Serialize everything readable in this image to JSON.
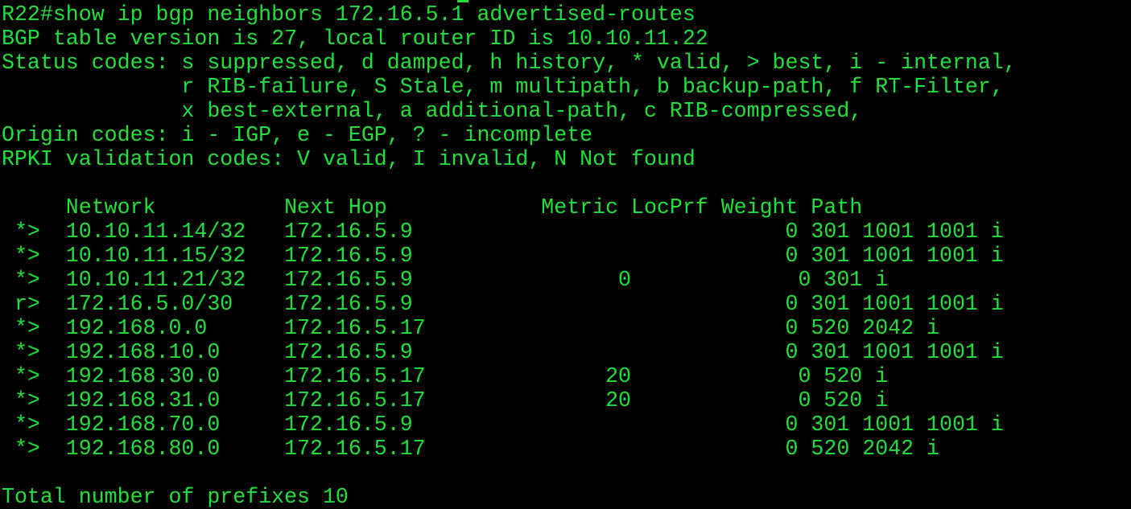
{
  "terminal": {
    "colors": {
      "background": "#000000",
      "text": "#22e03a"
    },
    "command_line": "R22#show ip bgp neighbors 172.16.5.1 advertised-routes",
    "header_lines": [
      "BGP table version is 27, local router ID is 10.10.11.22",
      "Status codes: s suppressed, d damped, h history, * valid, > best, i - internal,",
      "              r RIB-failure, S Stale, m multipath, b backup-path, f RT-Filter,",
      "              x best-external, a additional-path, c RIB-compressed,",
      "Origin codes: i - IGP, e - EGP, ? - incomplete",
      "RPKI validation codes: V valid, I invalid, N Not found"
    ],
    "table_header": "     Network          Next Hop            Metric LocPrf Weight Path",
    "routes": [
      " *>  10.10.11.14/32   172.16.5.9                             0 301 1001 1001 i",
      " *>  10.10.11.15/32   172.16.5.9                             0 301 1001 1001 i",
      " *>  10.10.11.21/32   172.16.5.9                0             0 301 i",
      " r>  172.16.5.0/30    172.16.5.9                             0 301 1001 1001 i",
      " *>  192.168.0.0      172.16.5.17                            0 520 2042 i",
      " *>  192.168.10.0     172.16.5.9                             0 301 1001 1001 i",
      " *>  192.168.30.0     172.16.5.17              20             0 520 i",
      " *>  192.168.31.0     172.16.5.17              20             0 520 i",
      " *>  192.168.70.0     172.16.5.9                             0 301 1001 1001 i",
      " *>  192.168.80.0     172.16.5.17                            0 520 2042 i"
    ],
    "footer": "Total number of prefixes 10"
  }
}
